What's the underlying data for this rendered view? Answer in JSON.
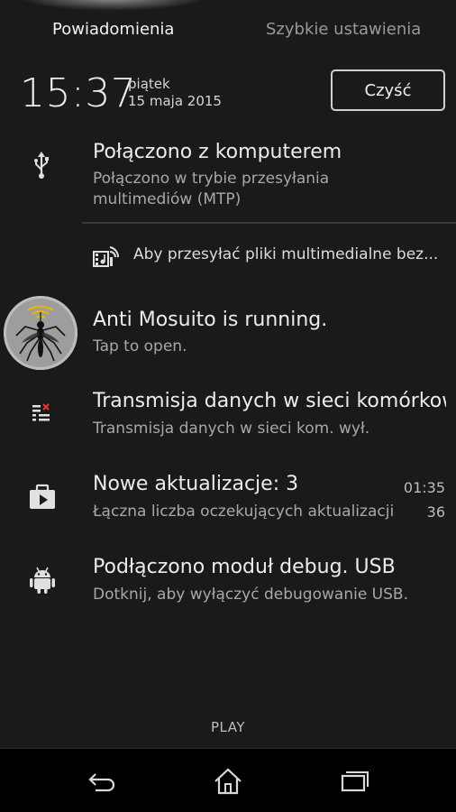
{
  "tabs": {
    "notifications": "Powiadomienia",
    "quick_settings": "Szybkie ustawienia"
  },
  "header": {
    "time": "15:37",
    "day": "piątek",
    "date": "15 maja 2015",
    "clear_label": "Czyść"
  },
  "notifications": [
    {
      "icon": "usb-icon",
      "title": "Połączono z komputerem",
      "subtitle_line1": "Połączono w trybie przesyłania",
      "subtitle_line2": "multimediów (MTP)"
    },
    {
      "icon": "media-wireless-icon",
      "text": "Aby przesyłać pliki multimedialne bez..."
    },
    {
      "icon": "mosquito-app-icon",
      "title": "Anti Mosuito is running.",
      "subtitle": "Tap to open."
    },
    {
      "icon": "data-off-icon",
      "title": "Transmisja danych w sieci komórkowej",
      "subtitle": "Transmisja danych w sieci kom. wył."
    },
    {
      "icon": "play-store-icon",
      "title": "Nowe aktualizacje: 3",
      "subtitle": "Łączna liczba oczekujących aktualizacji",
      "time": "01:35",
      "count": "36"
    },
    {
      "icon": "android-icon",
      "title": "Podłączono moduł debug. USB",
      "subtitle": "Dotknij, aby wyłączyć debugowanie USB."
    }
  ],
  "footer": {
    "play_label": "PLAY"
  },
  "navbar": {
    "back": "back-icon",
    "home": "home-icon",
    "recents": "recents-icon"
  }
}
